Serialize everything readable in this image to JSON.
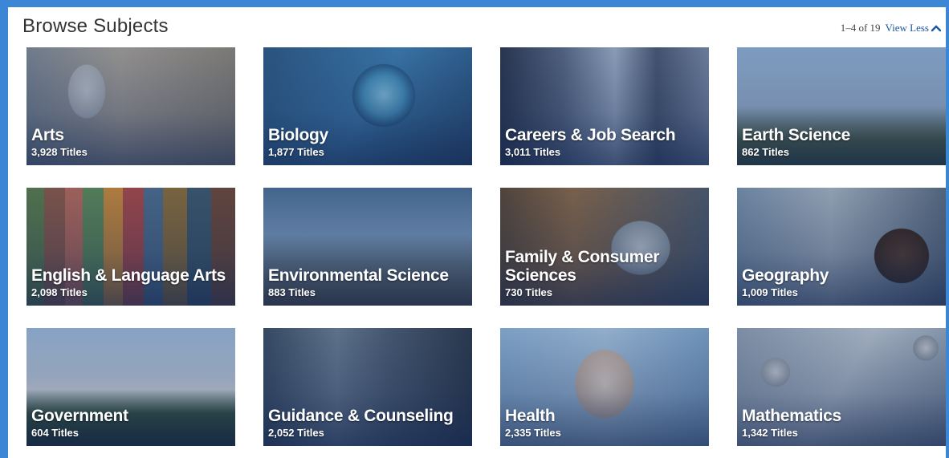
{
  "header": {
    "title": "Browse Subjects",
    "range": "1–4 of 19",
    "view_less_label": "View Less",
    "view_less_icon": "chevron-up-icon"
  },
  "colors": {
    "page_background": "#3b87d6",
    "link": "#1a56a8",
    "tile_overlay": "#122650"
  },
  "subjects": [
    {
      "name": "Arts",
      "count": "3,928 Titles"
    },
    {
      "name": "Biology",
      "count": "1,877 Titles"
    },
    {
      "name": "Careers & Job Search",
      "count": "3,011 Titles"
    },
    {
      "name": "Earth Science",
      "count": "862 Titles"
    },
    {
      "name": "English & Language Arts",
      "count": "2,098 Titles"
    },
    {
      "name": "Environmental Science",
      "count": "883 Titles"
    },
    {
      "name": "Family & Consumer Sciences",
      "count": "730 Titles"
    },
    {
      "name": "Geography",
      "count": "1,009 Titles"
    },
    {
      "name": "Government",
      "count": "604 Titles"
    },
    {
      "name": "Guidance & Counseling",
      "count": "2,052 Titles"
    },
    {
      "name": "Health",
      "count": "2,335 Titles"
    },
    {
      "name": "Mathematics",
      "count": "1,342 Titles"
    }
  ]
}
